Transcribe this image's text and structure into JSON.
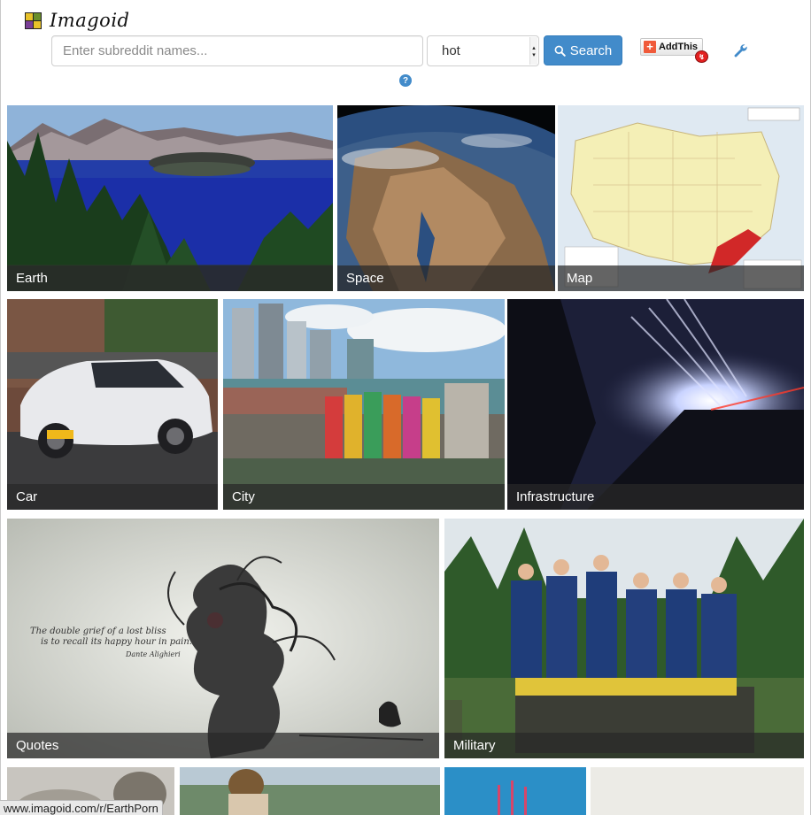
{
  "app": {
    "name": "Imagoid"
  },
  "search": {
    "placeholder": "Enter subreddit names...",
    "value": ""
  },
  "sort": {
    "selected": "hot"
  },
  "search_button": {
    "label": "Search",
    "icon": "search-icon"
  },
  "share": {
    "label": "AddThis",
    "icon": "plus-icon"
  },
  "settings": {
    "icon": "wrench-icon"
  },
  "help": {
    "label": "?",
    "icon": "help-icon"
  },
  "categories": [
    {
      "label": "Earth"
    },
    {
      "label": "Space"
    },
    {
      "label": "Map"
    },
    {
      "label": "Car"
    },
    {
      "label": "City"
    },
    {
      "label": "Infrastructure"
    },
    {
      "label": "Quotes"
    },
    {
      "label": "Military"
    }
  ],
  "quote_image": {
    "text_line1": "The double grief of a lost bliss",
    "text_line2": "is to recall its happy hour in pain.",
    "author": "Dante Alighieri"
  },
  "status_bar": {
    "url": "www.imagoid.com/r/EarthPorn"
  },
  "colors": {
    "accent": "#428bca",
    "caption_bg": "#282828"
  }
}
